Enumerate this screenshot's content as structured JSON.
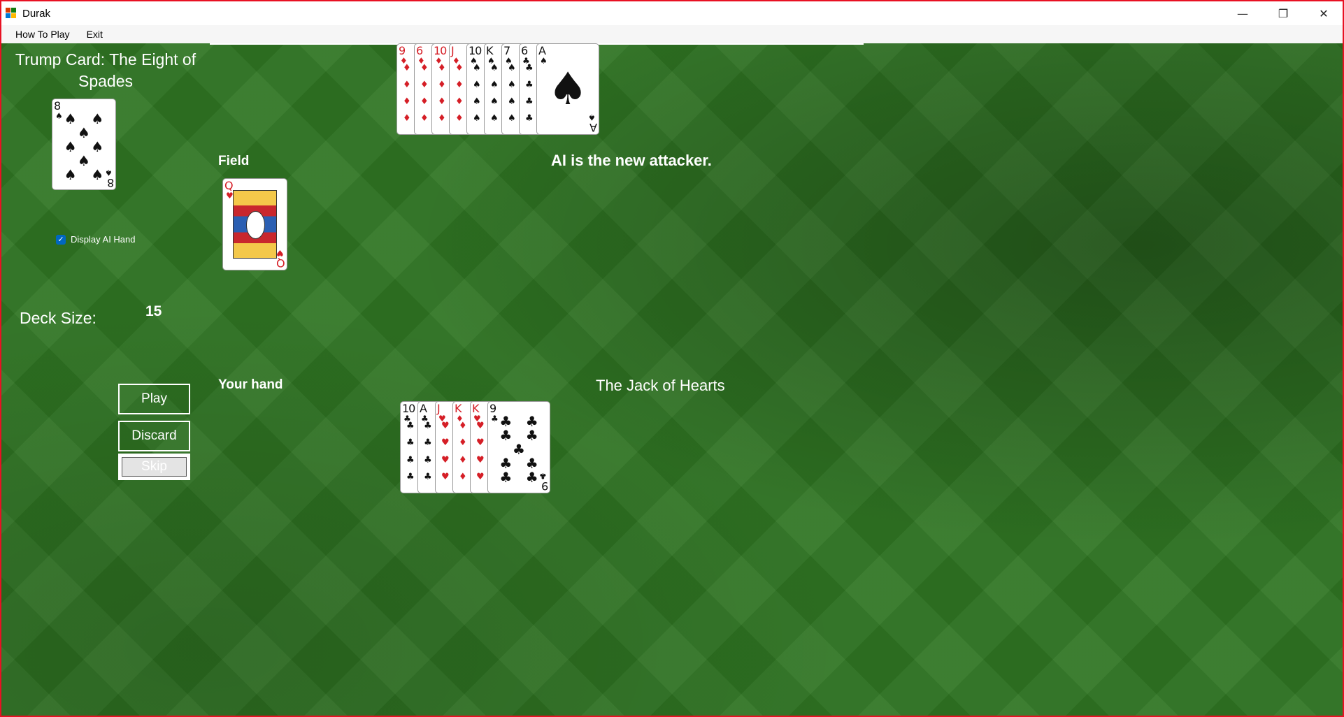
{
  "window": {
    "title": "Durak",
    "controls": [
      "—",
      "❐",
      "✕"
    ]
  },
  "menu": {
    "items": [
      "How To Play",
      "Exit"
    ]
  },
  "trump": {
    "label": "Trump Card: The Eight of Spades",
    "card": {
      "rank": "8",
      "suit": "♠",
      "color": "black"
    }
  },
  "ai_hand_toggle": {
    "label": "Display AI Hand",
    "checked": true,
    "check_glyph": "✓"
  },
  "deck": {
    "label": "Deck Size:",
    "size": "15"
  },
  "controls": {
    "play_label": "Play",
    "discard_label": "Discard",
    "skip_label": "Skip"
  },
  "field": {
    "label": "Field",
    "cards": [
      {
        "rank": "Q",
        "suit": "♥",
        "color": "red",
        "face": true
      }
    ]
  },
  "status": {
    "message": "AI is the new attacker."
  },
  "ai_hand": {
    "cards": [
      {
        "rank": "9",
        "suit": "♦",
        "color": "red"
      },
      {
        "rank": "6",
        "suit": "♦",
        "color": "red"
      },
      {
        "rank": "10",
        "suit": "♦",
        "color": "red"
      },
      {
        "rank": "J",
        "suit": "♦",
        "color": "red"
      },
      {
        "rank": "10",
        "suit": "♠",
        "color": "black"
      },
      {
        "rank": "K",
        "suit": "♠",
        "color": "black"
      },
      {
        "rank": "7",
        "suit": "♠",
        "color": "black"
      },
      {
        "rank": "6",
        "suit": "♣",
        "color": "black"
      },
      {
        "rank": "A",
        "suit": "♠",
        "color": "black"
      }
    ]
  },
  "player_hand": {
    "label": "Your hand",
    "selected_card_text": "The Jack of Hearts",
    "cards": [
      {
        "rank": "10",
        "suit": "♣",
        "color": "black"
      },
      {
        "rank": "A",
        "suit": "♣",
        "color": "black"
      },
      {
        "rank": "J",
        "suit": "♥",
        "color": "red"
      },
      {
        "rank": "K",
        "suit": "♦",
        "color": "red"
      },
      {
        "rank": "K",
        "suit": "♥",
        "color": "red"
      },
      {
        "rank": "9",
        "suit": "♣",
        "color": "black"
      }
    ]
  },
  "colors": {
    "felt": "#2f7422",
    "border": "#e81123",
    "checkbox": "#0067c0"
  }
}
